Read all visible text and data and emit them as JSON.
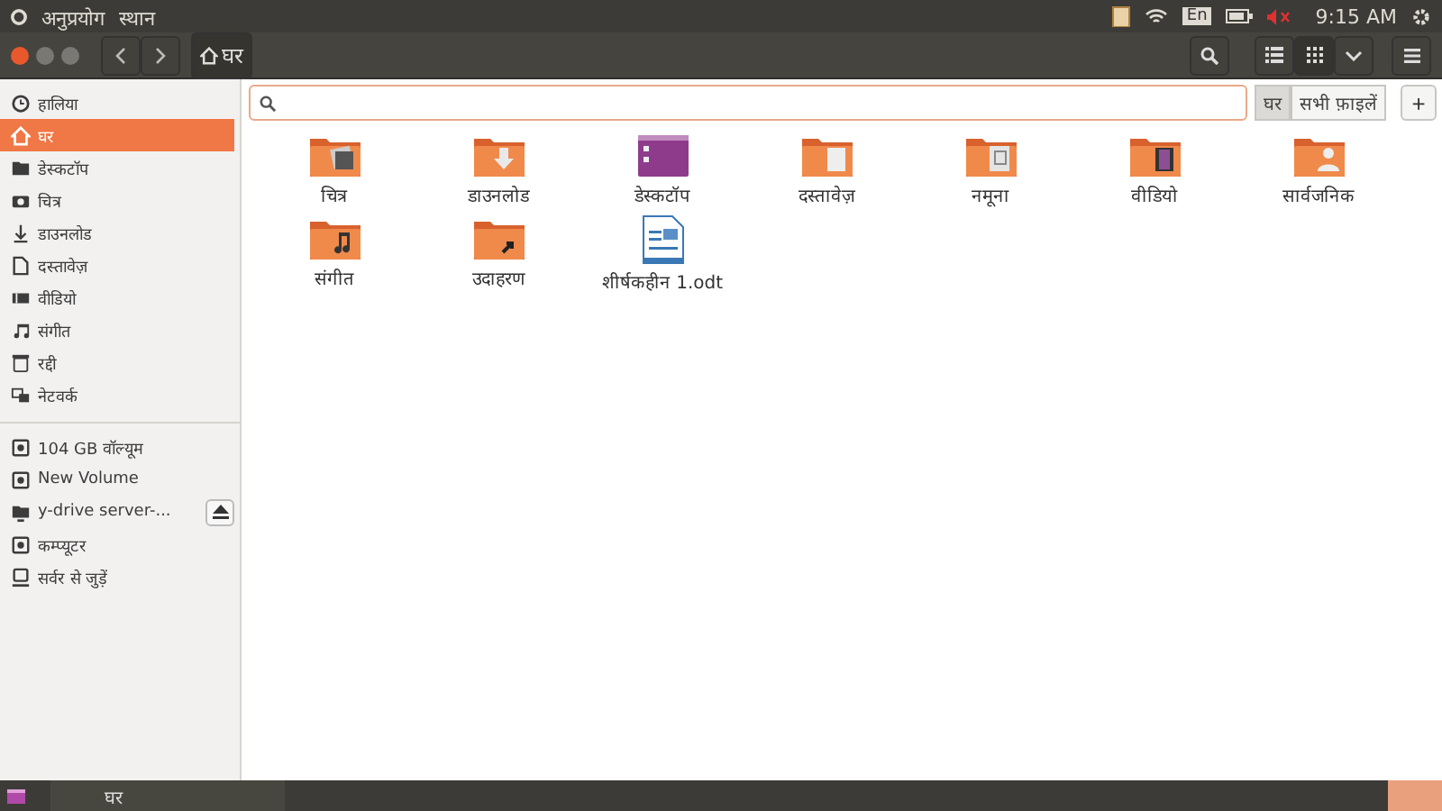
{
  "top_panel": {
    "menus": [
      "अनुप्रयोग",
      "स्थान"
    ],
    "keyboard": "En",
    "volume_muted": true,
    "time": "9:15 AM"
  },
  "toolbar": {
    "path": [
      {
        "label": "घर",
        "selected": true
      }
    ],
    "views": [
      {
        "kind": "list",
        "selected": false
      },
      {
        "kind": "grid",
        "selected": true
      },
      {
        "kind": "dropdown",
        "selected": false
      }
    ]
  },
  "sidebar": {
    "places": [
      {
        "kind": "recent",
        "label": "हालिया",
        "selected": false
      },
      {
        "kind": "home",
        "label": "घर",
        "selected": true
      },
      {
        "kind": "desktop",
        "label": "डेस्कटॉप",
        "selected": false
      },
      {
        "kind": "pictures",
        "label": "चित्र",
        "selected": false
      },
      {
        "kind": "downloads",
        "label": "डाउनलोड",
        "selected": false
      },
      {
        "kind": "documents",
        "label": "दस्तावेज़",
        "selected": false
      },
      {
        "kind": "videos",
        "label": "वीडियो",
        "selected": false
      },
      {
        "kind": "music",
        "label": "संगीत",
        "selected": false
      },
      {
        "kind": "trash",
        "label": "रद्दी",
        "selected": false
      },
      {
        "kind": "network",
        "label": "नेटवर्क",
        "selected": false
      }
    ],
    "devices": [
      {
        "kind": "drive",
        "label": "104 GB वॉल्यूम",
        "selected": false,
        "ejectable": false
      },
      {
        "kind": "drive",
        "label": "New Volume",
        "selected": false,
        "ejectable": false
      },
      {
        "kind": "share",
        "label": "y-drive server-...",
        "selected": false,
        "ejectable": true
      },
      {
        "kind": "drive",
        "label": "कम्प्यूटर",
        "selected": false,
        "ejectable": false
      },
      {
        "kind": "server",
        "label": "सर्वर से जुड़ें",
        "selected": false,
        "ejectable": false
      }
    ]
  },
  "search": {
    "scopes": [
      {
        "label": "घर",
        "selected": true
      },
      {
        "label": "सभी फ़ाइलें",
        "selected": false
      }
    ],
    "add_button": "+"
  },
  "files": [
    {
      "kind": "pictures",
      "name": "चित्र"
    },
    {
      "kind": "downloads",
      "name": "डाउनलोड"
    },
    {
      "kind": "desktop",
      "name": "डेस्कटॉप"
    },
    {
      "kind": "documents",
      "name": "दस्तावेज़"
    },
    {
      "kind": "templates",
      "name": "नमूना"
    },
    {
      "kind": "videos",
      "name": "वीडियो"
    },
    {
      "kind": "public",
      "name": "सार्वजनिक"
    },
    {
      "kind": "music",
      "name": "संगीत"
    },
    {
      "kind": "examples",
      "name": "उदाहरण"
    },
    {
      "kind": "document",
      "name": "शीर्षकहीन 1.odt"
    }
  ],
  "taskbar": {
    "windows": [
      "घर"
    ]
  }
}
